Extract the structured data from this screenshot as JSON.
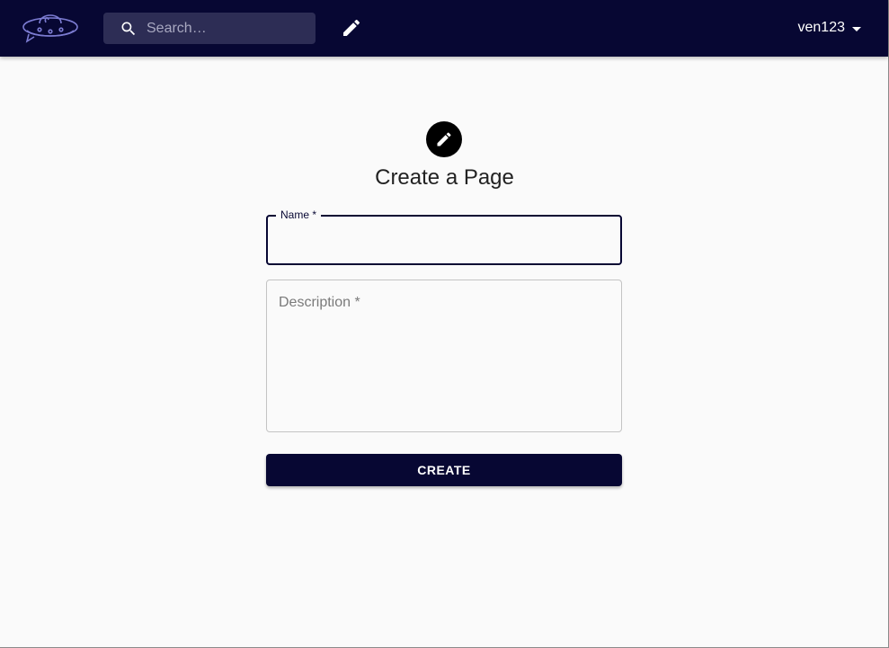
{
  "header": {
    "search": {
      "placeholder": "Search…",
      "value": ""
    },
    "user": {
      "username": "ven123"
    }
  },
  "icons": {
    "logo": "ufo-chat-logo-icon",
    "search": "search-icon",
    "nav_edit": "pencil-icon",
    "user_caret": "caret-down-icon",
    "form_avatar": "pencil-icon"
  },
  "colors": {
    "primary": "#070733",
    "search_bg": "#2d2d55",
    "page_bg": "#fafafa",
    "logo_stroke": "#7b7bd1"
  },
  "form": {
    "title": "Create a Page",
    "name": {
      "label": "Name *",
      "value": ""
    },
    "description": {
      "placeholder": "Description *",
      "value": ""
    },
    "submit_label": "CREATE"
  }
}
